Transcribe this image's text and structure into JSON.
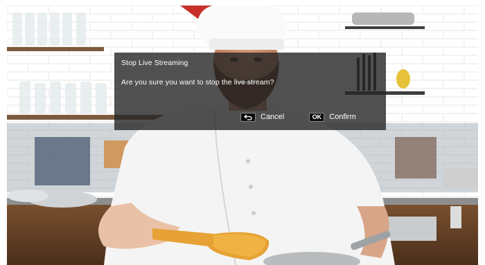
{
  "dialog": {
    "title": "Stop Live Streaming",
    "message": "Are you sure you want to stop the live stream?",
    "actions": {
      "cancel": {
        "key_icon": "back-key-icon",
        "label": "Cancel"
      },
      "confirm": {
        "key_icon": "ok-key-icon",
        "key_text": "OK",
        "label": "Confirm"
      }
    }
  },
  "video": {
    "subject": "chef-holding-wooden-spatula-in-kitchen"
  },
  "colors": {
    "dialog_bg": "#262626",
    "text": "#ffffff",
    "key_bg": "#0c0c0c"
  }
}
